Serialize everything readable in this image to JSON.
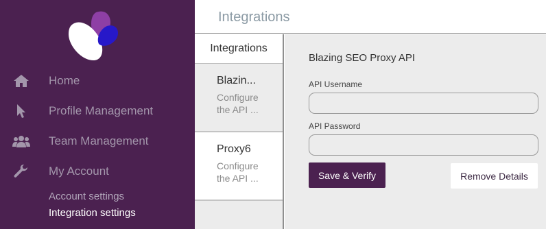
{
  "app": {
    "brand_colors": {
      "sidebar": "#4b2150",
      "logo_purple": "#8e3fa5",
      "logo_blue": "#2718c9"
    }
  },
  "sidebar": {
    "nav": [
      {
        "label": "Home",
        "icon": "home-icon"
      },
      {
        "label": "Profile Management",
        "icon": "pointer-icon"
      },
      {
        "label": "Team Management",
        "icon": "users-icon"
      },
      {
        "label": "My Account",
        "icon": "wrench-icon"
      }
    ],
    "sub": [
      {
        "label": "Account settings",
        "active": false
      },
      {
        "label": "Integration settings",
        "active": true
      }
    ]
  },
  "header": {
    "title": "Integrations"
  },
  "list": {
    "heading": "Integrations",
    "items": [
      {
        "title": "Blazin...",
        "desc": "Configure the API ...",
        "selected": true
      },
      {
        "title": "Proxy6",
        "desc": "Configure the API ...",
        "selected": false
      }
    ]
  },
  "detail": {
    "title": "Blazing SEO Proxy API",
    "username_label": "API Username",
    "username_value": "",
    "password_label": "API Password",
    "password_value": "",
    "save_label": "Save & Verify",
    "remove_label": "Remove Details"
  }
}
